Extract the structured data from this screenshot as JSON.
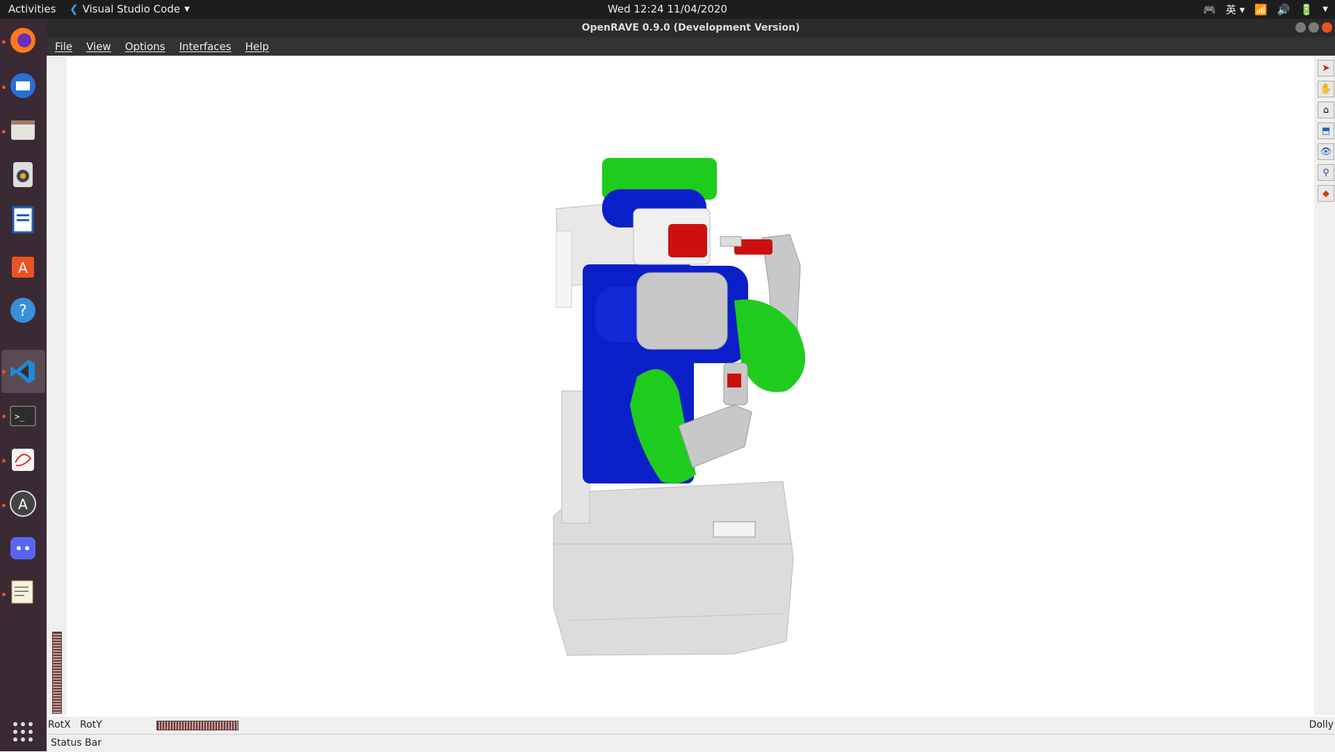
{
  "topbar": {
    "activities": "Activities",
    "app_name": "Visual Studio Code",
    "clock": "Wed 12:24   11/04/2020",
    "input_method": "英"
  },
  "window": {
    "title": "OpenRAVE 0.9.0 (Development Version)"
  },
  "menu": [
    "File",
    "View",
    "Options",
    "Interfaces",
    "Help"
  ],
  "viewer": {
    "rotx_label": "RotX",
    "roty_label": "RotY",
    "dolly_label": "Dolly"
  },
  "status": {
    "text": "Status Bar"
  },
  "colors": {
    "robot_blue": "#0b1fc8",
    "robot_green": "#1ecc1e",
    "robot_red": "#cc1010",
    "robot_gray": "#c8c8c8",
    "accent": "#e95420"
  },
  "dock_icons": [
    "firefox-icon",
    "thunderbird-icon",
    "files-icon",
    "rhythmbox-icon",
    "writer-icon",
    "software-icon",
    "help-icon",
    "vscode-icon",
    "terminal-icon",
    "xournal-icon",
    "updater-icon",
    "discord-icon",
    "text-editor-icon",
    "apps-grid-icon"
  ]
}
